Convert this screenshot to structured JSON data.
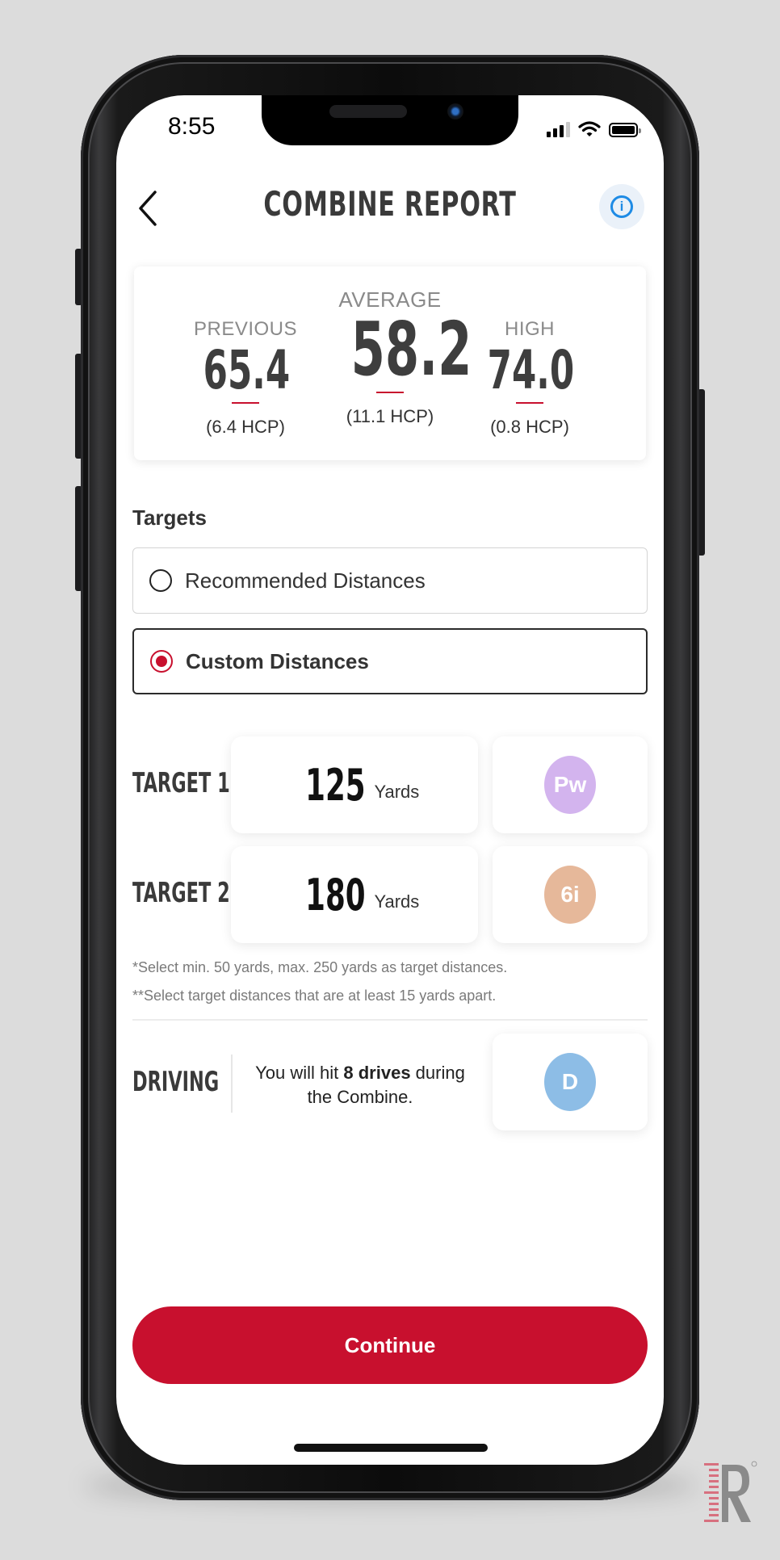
{
  "status_bar": {
    "time": "8:55",
    "icons": [
      "signal-icon",
      "wifi-icon",
      "battery-icon"
    ]
  },
  "header": {
    "title": "COMBINE REPORT",
    "back_icon": "chevron-left-icon",
    "info_icon": "info-icon",
    "info_glyph": "i"
  },
  "stats": {
    "previous": {
      "label": "PREVIOUS",
      "value": "65.4",
      "hcp": "(6.4 HCP)"
    },
    "average": {
      "label": "AVERAGE",
      "value": "58.2",
      "hcp": "(11.1 HCP)"
    },
    "high": {
      "label": "HIGH",
      "value": "74.0",
      "hcp": "(0.8 HCP)"
    }
  },
  "targets": {
    "section_title": "Targets",
    "options": [
      {
        "label": "Recommended Distances",
        "selected": false
      },
      {
        "label": "Custom Distances",
        "selected": true
      }
    ],
    "rows": [
      {
        "label": "TARGET 1",
        "distance": "125",
        "unit": "Yards",
        "club": "Pw",
        "club_color": "#d3b4ee"
      },
      {
        "label": "TARGET 2",
        "distance": "180",
        "unit": "Yards",
        "club": "6i",
        "club_color": "#e6b89a"
      }
    ],
    "notes": [
      "*Select min. 50 yards, max. 250 yards as target distances.",
      "**Select target distances that are at least 15 yards apart."
    ]
  },
  "driving": {
    "label": "DRIVING",
    "text_before": "You will hit ",
    "text_bold": "8 drives",
    "text_after": " during the Combine.",
    "club": "D",
    "club_color": "#8dbde6"
  },
  "footer": {
    "continue_label": "Continue"
  },
  "colors": {
    "accent": "#c8102e",
    "info_blue": "#1e8be5",
    "background": "#dcdcdc"
  }
}
